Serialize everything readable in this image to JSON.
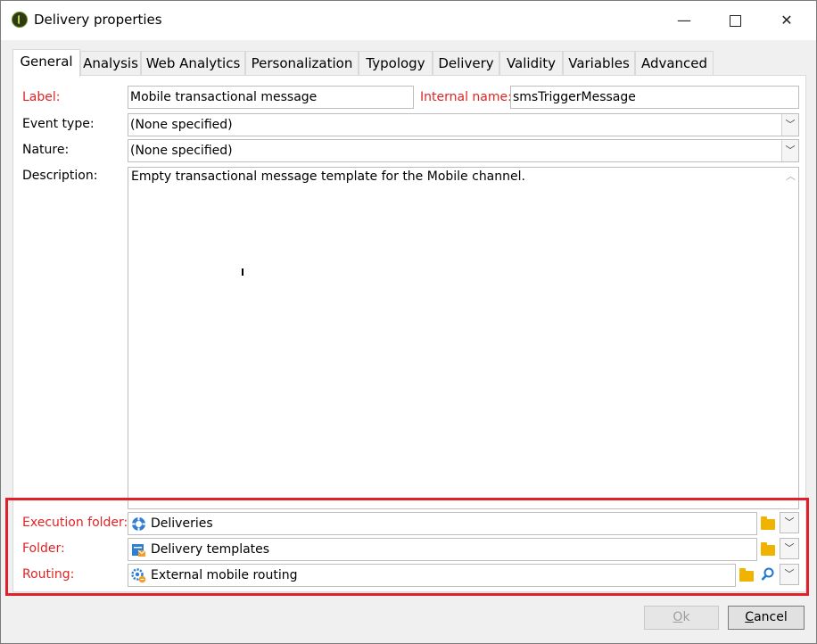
{
  "window": {
    "title": "Delivery properties"
  },
  "titlebar": {
    "minimize": "—",
    "maximize": "",
    "close": "✕"
  },
  "tabs": [
    "General",
    "Analysis",
    "Web Analytics",
    "Personalization",
    "Typology",
    "Delivery",
    "Validity",
    "Variables",
    "Advanced"
  ],
  "form": {
    "label_label": "Label:",
    "label_value": "Mobile transactional message",
    "internal_name_label": "Internal name:",
    "internal_name_value": "smsTriggerMessage",
    "event_type_label": "Event type:",
    "event_type_value": "(None specified)",
    "nature_label": "Nature:",
    "nature_value": "(None specified)",
    "description_label": "Description:",
    "description_value": "Empty transactional message template for the Mobile channel.",
    "execution_folder_label": "Execution folder:",
    "execution_folder_value": "Deliveries",
    "folder_label": "Folder:",
    "folder_value": "Delivery templates",
    "routing_label": "Routing:",
    "routing_value": "External mobile routing"
  },
  "buttons": {
    "ok_first": "O",
    "ok_rest": "k",
    "cancel_first": "C",
    "cancel_rest": "ancel"
  },
  "icons": {
    "app": "app-logo-icon",
    "execution_folder": "deliveries-folder-icon",
    "folder": "delivery-templates-icon",
    "routing": "routing-gear-icon",
    "browse": "folder-icon",
    "search": "magnifier-icon",
    "dropdown": "chevron-down-icon"
  },
  "colors": {
    "required_label": "#e02424",
    "highlight_box": "#e0202a"
  }
}
